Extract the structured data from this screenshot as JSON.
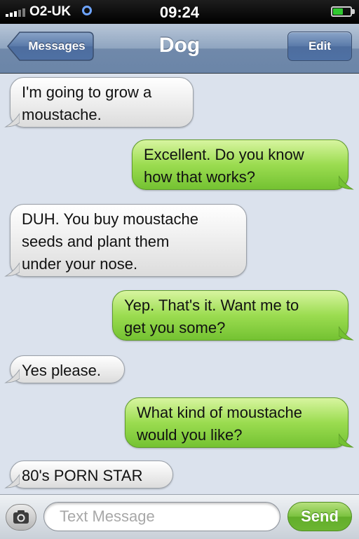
{
  "status_bar": {
    "carrier": "O2-UK",
    "time": "09:24",
    "battery_level": 0.6
  },
  "nav": {
    "back_label": "Messages",
    "title": "Dog",
    "edit_label": "Edit"
  },
  "messages": [
    {
      "direction": "incoming",
      "lines": [
        "I'm going to grow a",
        "moustache."
      ]
    },
    {
      "direction": "outgoing",
      "lines": [
        "Excellent. Do you know",
        "how that works?"
      ]
    },
    {
      "direction": "incoming",
      "lines": [
        "DUH. You buy moustache",
        "seeds and plant them",
        "under your nose."
      ]
    },
    {
      "direction": "outgoing",
      "lines": [
        "Yep. That's it. Want me to",
        "get you some?"
      ]
    },
    {
      "direction": "incoming",
      "lines": [
        "Yes please."
      ]
    },
    {
      "direction": "outgoing",
      "lines": [
        "What kind of moustache",
        "would you like?"
      ]
    },
    {
      "direction": "incoming",
      "lines": [
        "80's PORN STAR"
      ]
    }
  ],
  "input_bar": {
    "placeholder": "Text Message",
    "send_label": "Send"
  },
  "colors": {
    "incoming_bubble": "#ececec",
    "outgoing_bubble": "#8fd449",
    "background": "#dbe2ed"
  },
  "icons": {
    "camera": "camera-icon",
    "back": "back-arrow-button",
    "wifi": "wifi-icon",
    "signal": "signal-bars-icon",
    "battery": "battery-icon"
  }
}
